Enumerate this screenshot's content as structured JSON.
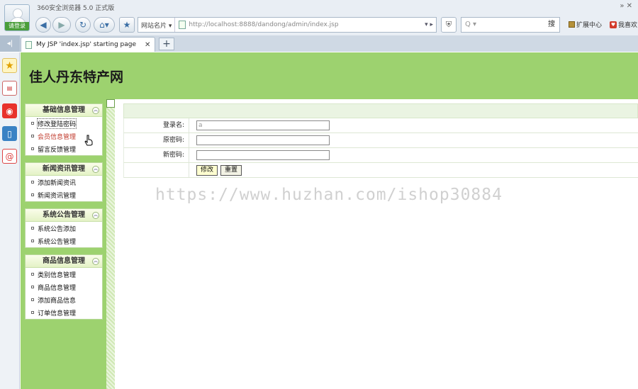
{
  "browser": {
    "app_title": "360安全浏览器 5.0 正式版",
    "login_label": "请登录",
    "top_right": "» ✕",
    "address_dropdown": "网站名片 ▾",
    "url": "http://localhost:8888/dandong/admin/index.jsp",
    "addr_arrows": "▾ ▸",
    "search_placeholder": "Q ▾",
    "search_button": "搜",
    "extensions": "扩展中心",
    "favorite": "我喜欢",
    "tab_title": "My JSP 'index.jsp' starting page",
    "tab_close": "✕",
    "new_tab": "+",
    "collapse": "◂|"
  },
  "site": {
    "title": "佳人丹东特产网"
  },
  "menus": [
    {
      "title": "基础信息管理",
      "items": [
        "修改登陆密码",
        "会员信息管理",
        "留言反馈管理"
      ]
    },
    {
      "title": "新闻资讯管理",
      "items": [
        "添加新闻资讯",
        "新闻资讯管理"
      ]
    },
    {
      "title": "系统公告管理",
      "items": [
        "系统公告添加",
        "系统公告管理"
      ]
    },
    {
      "title": "商品信息管理",
      "items": [
        "类别信息管理",
        "商品信息管理",
        "添加商品信息",
        "订单信息管理"
      ]
    }
  ],
  "form": {
    "username_label": "登录名:",
    "username_value": "a",
    "old_password_label": "原密码:",
    "new_password_label": "新密码:",
    "submit": "修改",
    "reset": "重置"
  },
  "watermark": "https://www.huzhan.com/ishop30884"
}
